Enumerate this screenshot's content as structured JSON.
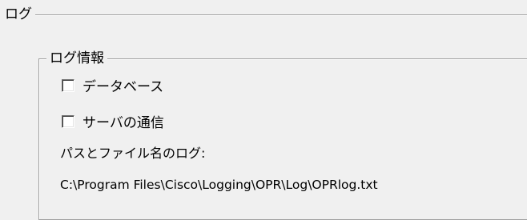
{
  "group": {
    "title": "ログ"
  },
  "log_info": {
    "title": "ログ情報",
    "checkboxes": [
      {
        "label": "データベース",
        "checked": false
      },
      {
        "label": "サーバの通信",
        "checked": false
      }
    ],
    "path_label": "パスとファイル名のログ:",
    "path_value": "C:\\Program Files\\Cisco\\Logging\\OPR\\Log\\OPRlog.txt"
  }
}
